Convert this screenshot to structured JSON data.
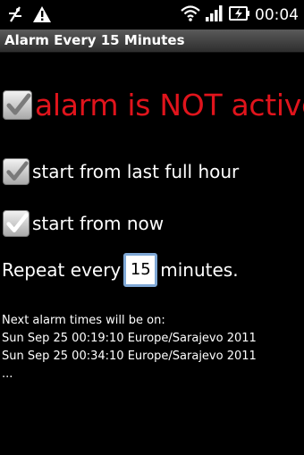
{
  "status_bar": {
    "time": "00:04",
    "icons": [
      "usb-debug-icon",
      "warning-icon",
      "wifi-icon",
      "signal-icon",
      "battery-charging-icon"
    ]
  },
  "title_bar": {
    "title": "Alarm Every 15 Minutes"
  },
  "alarm_status": {
    "label": "alarm is NOT active",
    "checked": true,
    "color": "#e0141c"
  },
  "options": [
    {
      "label": "start from last full hour",
      "checked": true
    },
    {
      "label": "start from now",
      "checked": true
    }
  ],
  "repeat": {
    "prefix": "Repeat every",
    "value": "15",
    "suffix": "minutes."
  },
  "next_alarms": {
    "heading": "Next alarm times will be on:",
    "times": [
      "Sun Sep 25 00:19:10 Europe/Sarajevo 2011",
      "Sun Sep 25 00:34:10 Europe/Sarajevo 2011"
    ],
    "ellipsis": "..."
  }
}
